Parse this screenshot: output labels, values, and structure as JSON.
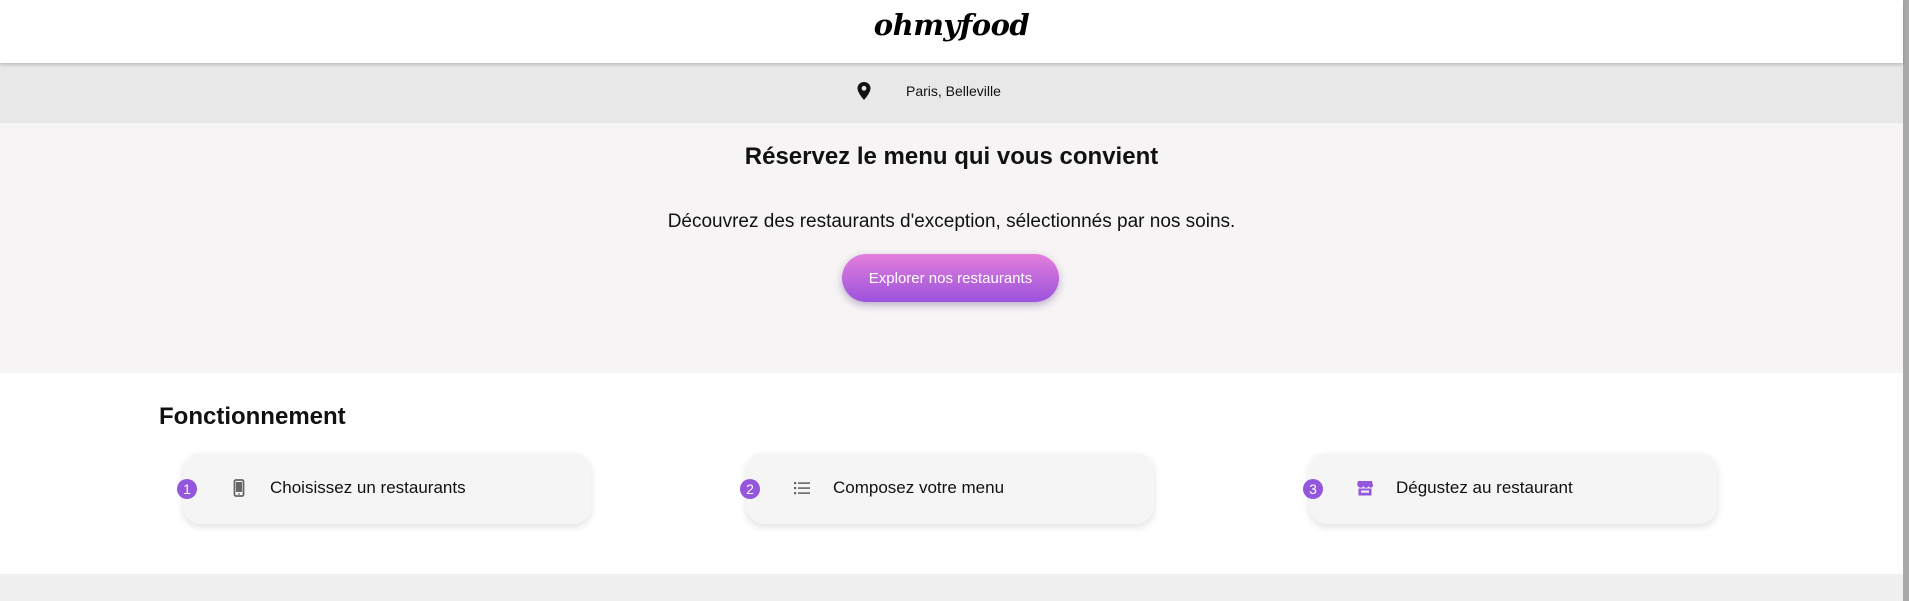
{
  "header": {
    "logo_text": "ohmyfood"
  },
  "location": {
    "icon": "map-pin-icon",
    "text": "Paris, Belleville"
  },
  "hero": {
    "title": "Réservez le menu qui vous convient",
    "subtitle": "Découvrez des restaurants d'exception, sélectionnés par nos soins.",
    "button_label": "Explorer nos restaurants"
  },
  "how_it_works": {
    "title": "Fonctionnement",
    "steps": [
      {
        "number": "1",
        "icon": "smartphone-icon",
        "label": "Choisissez un restaurants"
      },
      {
        "number": "2",
        "icon": "list-icon",
        "label": "Composez votre menu"
      },
      {
        "number": "3",
        "icon": "store-icon",
        "label": "Dégustez au restaurant"
      }
    ]
  },
  "colors": {
    "accent_start": "#e37fdb",
    "accent_end": "#9b52dc",
    "step_badge": "#9356dc"
  }
}
